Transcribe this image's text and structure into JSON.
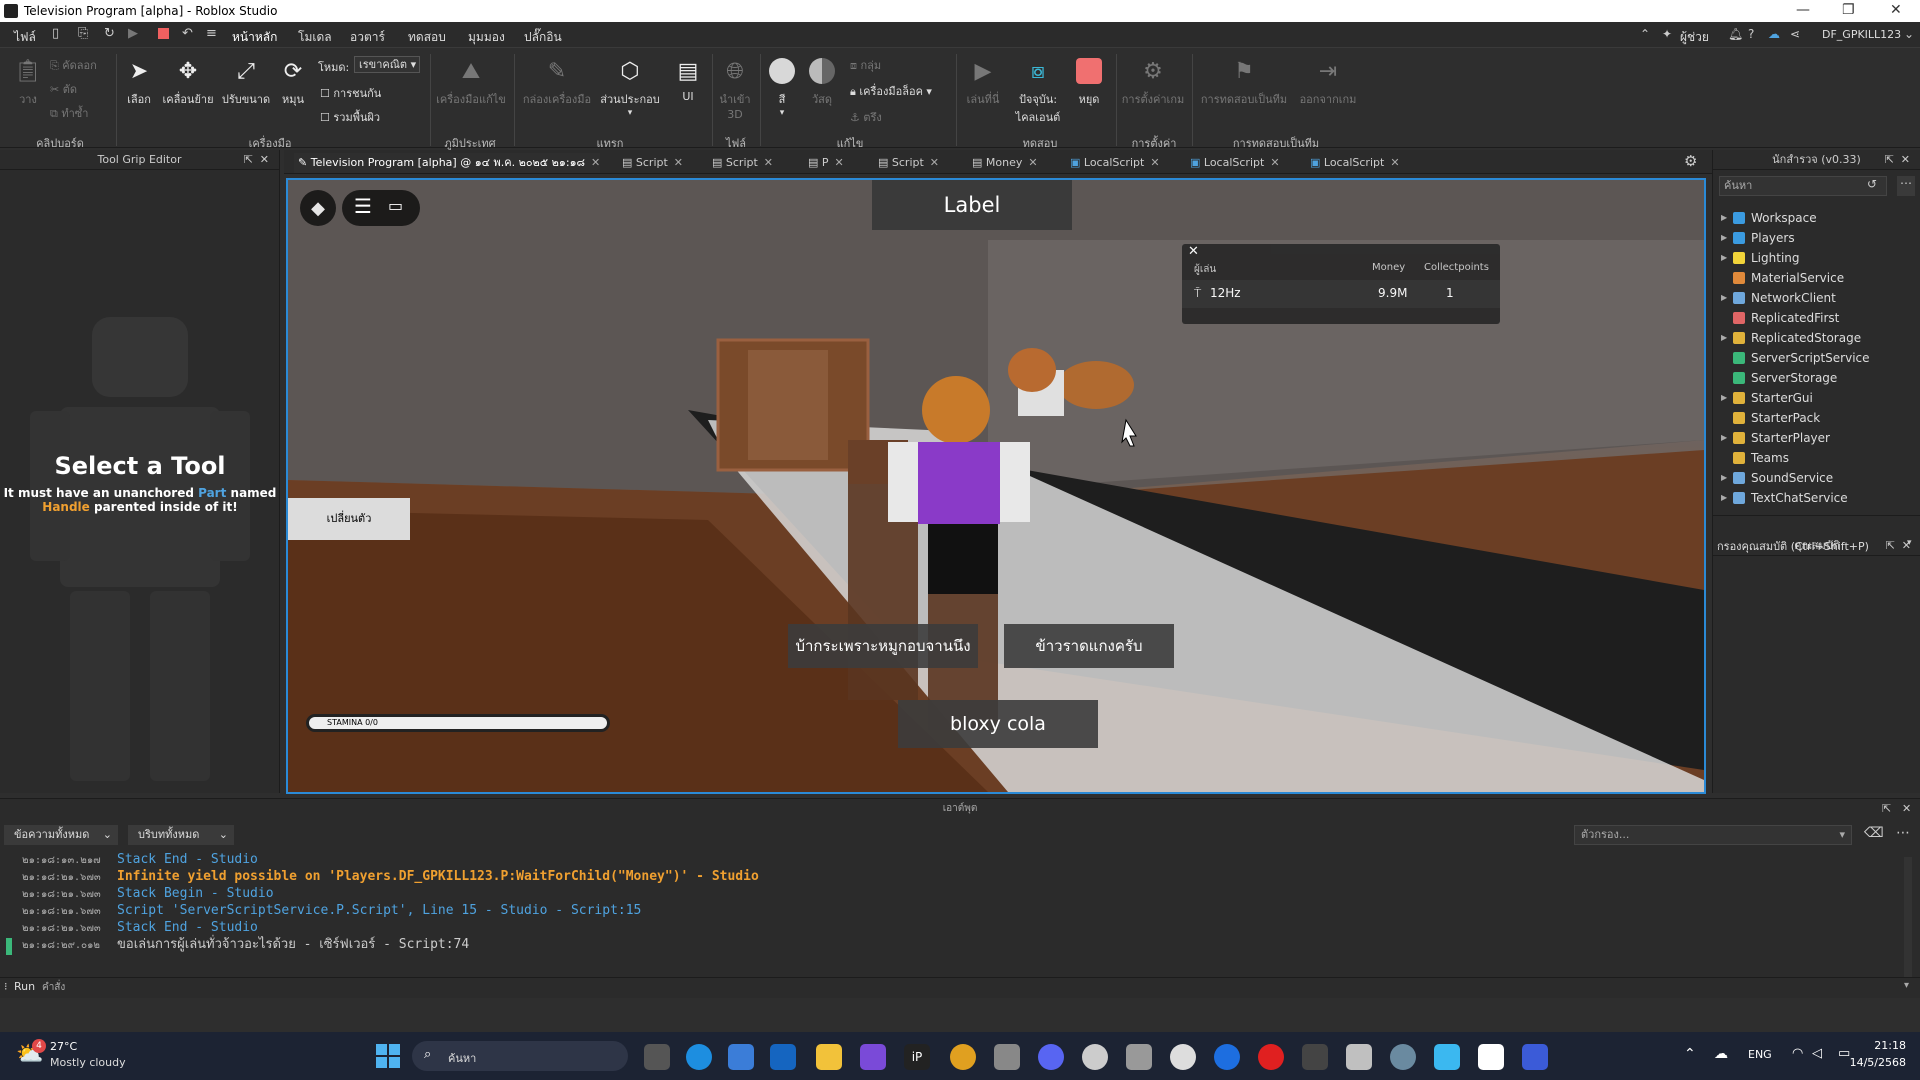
{
  "window": {
    "title": "Television Program [alpha] - Roblox Studio"
  },
  "menu": {
    "items": [
      "ไฟล์",
      "หน้าหลัก",
      "โมเดล",
      "อวตาร์",
      "ทดสอบ",
      "มุมมอง",
      "ปลั๊กอิน"
    ],
    "help": "ผู้ช่วย",
    "user": "DF_GPKILL123"
  },
  "ribbon": {
    "clipboard": {
      "paste": "วาง",
      "copy": "คัดลอก",
      "cut": "ตัด",
      "duplicate": "ทำซ้ำ",
      "group": "คลิปบอร์ด"
    },
    "tools": {
      "select": "เลือก",
      "move": "เคลื่อนย้าย",
      "scale": "ปรับขนาด",
      "rotate": "หมุน",
      "mode_label": "โหมด:",
      "mode_value": "เรขาคณิต",
      "collisions": "การชนกัน",
      "join_surfaces": "รวมพื้นผิว",
      "group": "เครื่องมือ"
    },
    "terrain": {
      "editor": "เครื่องมือแก้ไข",
      "group": "ภูมิประเทศ"
    },
    "insert": {
      "toolbox": "กล่องเครื่องมือ",
      "part": "ส่วนประกอบ",
      "ui": "UI",
      "group": "แทรก"
    },
    "file": {
      "import3d": "นำเข้า 3D",
      "group": "ไฟล์"
    },
    "edit": {
      "color": "สี",
      "material": "วัสดุ",
      "group_btn": "กลุ่ม",
      "lock": "เครื่องมือล็อค",
      "anchor": "ตรึง",
      "group": "แก้ไข"
    },
    "test": {
      "play": "เล่นที่นี่",
      "client": "ปัจจุบัน: ไคลเอนต์",
      "stop": "หยุด",
      "group": "ทดสอบ"
    },
    "settings": {
      "game_settings": "การตั้งค่าเกม",
      "group": "การตั้งค่า"
    },
    "team_test": {
      "team_test": "การทดสอบเป็นทีม",
      "exit": "ออกจากเกม",
      "group": "การทดสอบเป็นทีม"
    }
  },
  "left_panel": {
    "title": "Tool Grip Editor",
    "heading": "Select a Tool",
    "line1_a": "It must have an unanchored ",
    "line1_part": "Part",
    "line1_b": " named",
    "line2_handle": "Handle",
    "line2_b": " parented inside of it!"
  },
  "tabs": [
    {
      "label": "Television Program [alpha] @ ๑๔ พ.ค. ๒๐๒๕ ๒๑:๑๘"
    },
    {
      "label": "Script"
    },
    {
      "label": "Script"
    },
    {
      "label": "P"
    },
    {
      "label": "Script"
    },
    {
      "label": "Money"
    },
    {
      "label": "LocalScript"
    },
    {
      "label": "LocalScript"
    },
    {
      "label": "LocalScript"
    }
  ],
  "viewport": {
    "top_label": "Label",
    "side_button": "เปลี่ยนตัว",
    "leaderboard": {
      "col_user": "ผู้เล่น",
      "col_money": "Money",
      "col_collect": "Collectpoints",
      "player": "12Hz",
      "money": "9.9M",
      "collect": "1"
    },
    "menu_a": "บ้ากระเพราะหมูกอบจานนึง",
    "menu_b": "ข้าวราดแกงครับ",
    "menu_c": "bloxy cola",
    "stamina": "STAMINA 0/0",
    "stamina_fraction": 0.0
  },
  "explorer": {
    "title": "นักสำรวจ (v0.33)",
    "search_placeholder": "ค้นหา",
    "items": [
      {
        "label": "Workspace",
        "color": "#3b9be0",
        "expand": true
      },
      {
        "label": "Players",
        "color": "#3b9be0",
        "expand": true
      },
      {
        "label": "Lighting",
        "color": "#f2d43a",
        "expand": true
      },
      {
        "label": "MaterialService",
        "color": "#e08a3b",
        "expand": false
      },
      {
        "label": "NetworkClient",
        "color": "#6fa8dc",
        "expand": true
      },
      {
        "label": "ReplicatedFirst",
        "color": "#e06666",
        "expand": false
      },
      {
        "label": "ReplicatedStorage",
        "color": "#e0b23b",
        "expand": true
      },
      {
        "label": "ServerScriptService",
        "color": "#3bb87a",
        "expand": false
      },
      {
        "label": "ServerStorage",
        "color": "#3bb87a",
        "expand": false
      },
      {
        "label": "StarterGui",
        "color": "#e0b23b",
        "expand": true
      },
      {
        "label": "StarterPack",
        "color": "#e0b23b",
        "expand": false
      },
      {
        "label": "StarterPlayer",
        "color": "#e0b23b",
        "expand": true
      },
      {
        "label": "Teams",
        "color": "#e0b23b",
        "expand": false
      },
      {
        "label": "SoundService",
        "color": "#6fa8dc",
        "expand": true
      },
      {
        "label": "TextChatService",
        "color": "#6fa8dc",
        "expand": true
      }
    ]
  },
  "properties": {
    "title": "คุณสมบัติ",
    "filter": "กรองคุณสมบัติ (Ctrl+Shift+P)"
  },
  "output": {
    "title": "เอาต์พุต",
    "filter_messages": "ข้อความทั้งหมด",
    "filter_contexts": "บริบททั้งหมด",
    "filter_placeholder": "ตัวกรอง...",
    "lines": [
      {
        "ts": "๒๑:๑๘:๑๓.๒๑๗",
        "text": "Stack End  -  Studio",
        "color": "#4fa3e0",
        "bold": false
      },
      {
        "ts": "๒๑:๑๘:๒๑.๖๗๓",
        "text": "Infinite yield possible on 'Players.DF_GPKILL123.P:WaitForChild(\"Money\")'  -  Studio",
        "color": "#f0a030",
        "bold": true
      },
      {
        "ts": "๒๑:๑๘:๒๑.๖๗๓",
        "text": "Stack Begin  -  Studio",
        "color": "#4fa3e0",
        "bold": false
      },
      {
        "ts": "๒๑:๑๘:๒๑.๖๗๓",
        "text": "Script 'ServerScriptService.P.Script', Line 15  -  Studio - Script:15",
        "color": "#4fa3e0",
        "bold": false
      },
      {
        "ts": "๒๑:๑๘:๒๑.๖๗๓",
        "text": "Stack End  -  Studio",
        "color": "#4fa3e0",
        "bold": false
      },
      {
        "ts": "๒๑:๑๘:๒๙.๐๑๒",
        "text": "ขอเล่นการผู้เล่นทั่วจ้าวอะไรด้วย  -  เซิร์ฟเวอร์ - Script:74",
        "color": "#cccccc",
        "bold": false
      }
    ]
  },
  "command_bar": {
    "label": "Run",
    "placeholder": "คำสั่ง"
  },
  "taskbar": {
    "temp": "27°C",
    "weather": "Mostly cloudy",
    "search": "ค้นหา",
    "lang": "ENG",
    "time": "21:18",
    "date": "14/5/2568",
    "weather_badge": "4"
  }
}
